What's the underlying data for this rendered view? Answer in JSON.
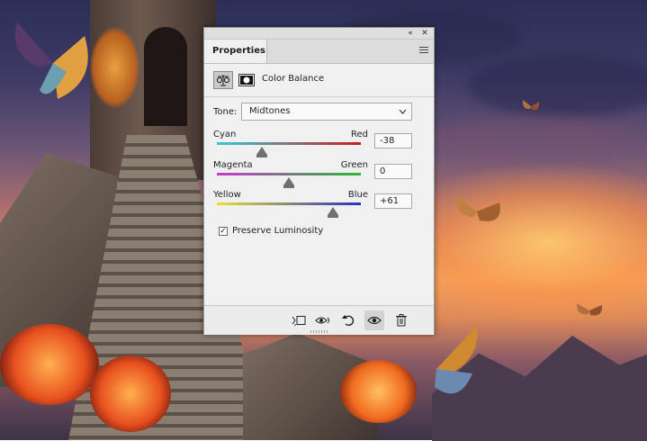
{
  "panel": {
    "collapse_label": "«",
    "close_label": "✕",
    "tab_label": "Properties",
    "menu_icon": "panel-menu-icon",
    "adjustment_icon": "balance-scale-icon",
    "mask_icon": "layer-mask-icon",
    "adjustment_title": "Color Balance"
  },
  "tone": {
    "label": "Tone:",
    "value": "Midtones"
  },
  "sliders": [
    {
      "left_label": "Cyan",
      "right_label": "Red",
      "value": "-38",
      "number": -38,
      "from": "#38c8d8",
      "to": "#c81e1e"
    },
    {
      "left_label": "Magenta",
      "right_label": "Green",
      "value": "0",
      "number": 0,
      "from": "#c83cc8",
      "to": "#2cb83c"
    },
    {
      "left_label": "Yellow",
      "right_label": "Blue",
      "value": "+61",
      "number": 61,
      "from": "#e8e030",
      "to": "#2830c0"
    }
  ],
  "preserve": {
    "label": "Preserve Luminosity",
    "checked": true,
    "check_glyph": "✓"
  },
  "footer": {
    "buttons": [
      "clip-to-layer-icon",
      "view-previous-state-icon",
      "reset-icon",
      "visibility-eye-icon",
      "trash-icon"
    ]
  }
}
